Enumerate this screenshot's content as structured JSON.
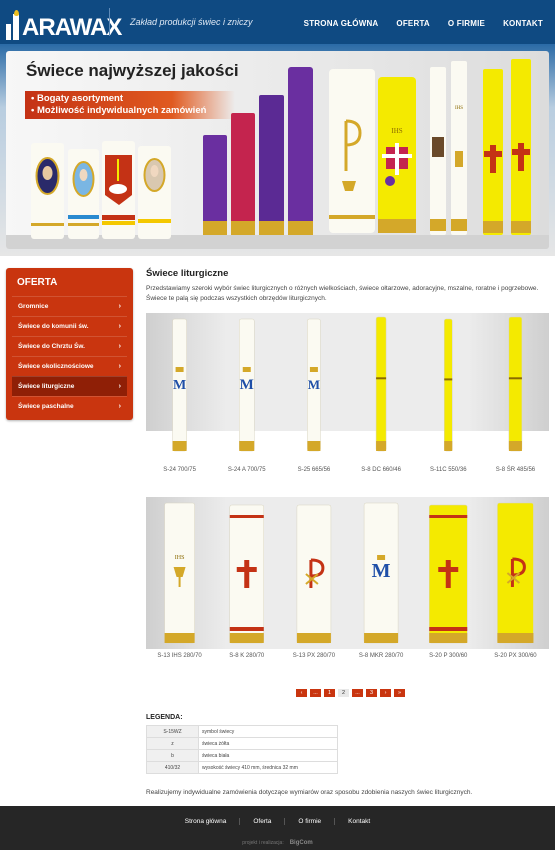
{
  "header": {
    "logo_text": "ARAWAX",
    "tagline": "Zakład produkcji świec i zniczy",
    "nav": [
      "STRONA GŁÓWNA",
      "OFERTA",
      "O FIRMIE",
      "KONTAKT"
    ]
  },
  "hero": {
    "title": "Świece najwyższej jakości",
    "bullets": [
      "• Bogaty asortyment",
      "• Możliwość indywidualnych zamówień"
    ],
    "decor_text": [
      "IHS",
      "IHS"
    ]
  },
  "sidebar": {
    "title": "OFERTA",
    "items": [
      {
        "label": "Gromnice",
        "active": false
      },
      {
        "label": "Świece do komunii św.",
        "active": false
      },
      {
        "label": "Świece do Chrztu Św.",
        "active": false
      },
      {
        "label": "Świece okolicznościowe",
        "active": false
      },
      {
        "label": "Świece liturgiczne",
        "active": true
      },
      {
        "label": "Świece paschalne",
        "active": false
      }
    ],
    "chevron": "›"
  },
  "main": {
    "title": "Świece liturgiczne",
    "intro": "Przedstawiamy szeroki wybór świec liturgicznych o różnych wielkościach, świece ołtarzowe, adoracyjne, mszalne, roratne i pogrzebowe. Świece te palą się podczas wszystkich obrzędów liturgicznych."
  },
  "products_row1": [
    {
      "code": "S-24 700/75",
      "color": "white",
      "decor": "M-blue"
    },
    {
      "code": "S-24 A 700/75",
      "color": "white",
      "decor": "M-blue"
    },
    {
      "code": "S-25 665/56",
      "color": "white",
      "decor": "M-blue"
    },
    {
      "code": "S-8 DC 660/46",
      "color": "yellow",
      "decor": "band"
    },
    {
      "code": "S-11C 550/36",
      "color": "yellow",
      "decor": "band"
    },
    {
      "code": "S-8 ŚR 485/56",
      "color": "yellow",
      "decor": "band"
    }
  ],
  "products_row2": [
    {
      "code": "S-13 IHS 280/70",
      "color": "white",
      "decor": "chalice"
    },
    {
      "code": "S-8 K 280/70",
      "color": "white",
      "decor": "cross-red"
    },
    {
      "code": "S-13 PX 280/70",
      "color": "white",
      "decor": "px"
    },
    {
      "code": "S-8 MKR 280/70",
      "color": "white",
      "decor": "M-blue"
    },
    {
      "code": "S-20 P 300/60",
      "color": "yellow",
      "decor": "cross-red"
    },
    {
      "code": "S-20 PX 300/60",
      "color": "yellow",
      "decor": "px"
    }
  ],
  "product_decor_text": "IHS",
  "pagination": [
    {
      "label": "‹",
      "current": false
    },
    {
      "label": "...",
      "current": false
    },
    {
      "label": "1",
      "current": false
    },
    {
      "label": "2",
      "current": true
    },
    {
      "label": "...",
      "current": false
    },
    {
      "label": "3",
      "current": false
    },
    {
      "label": "›",
      "current": false
    },
    {
      "label": "»",
      "current": false
    }
  ],
  "legend": {
    "title": "LEGENDA:",
    "rows": [
      {
        "key": "S-15WZ",
        "value": "symbol świecy"
      },
      {
        "key": "z",
        "value": "świeca żółta"
      },
      {
        "key": "b",
        "value": "świeca biała"
      },
      {
        "key": "410/32",
        "value": "wysokość świecy 410 mm, średnica 32 mm"
      }
    ]
  },
  "outro": "Realizujemy indywidualne zamówienia dotyczące wymiarów oraz sposobu zdobienia naszych świec liturgicznych.",
  "footer": {
    "nav": [
      "Strona główna",
      "Oferta",
      "O firmie",
      "Kontakt"
    ],
    "credits": "projekt i realizacja:",
    "credits_brand": "BigCom"
  },
  "colors": {
    "header": "#0f4a82",
    "accent": "#c9350f",
    "candle_yellow": "#f4ea00",
    "candle_white": "#fbfaf2",
    "purple": "#6a2fa0",
    "magenta": "#c4244e",
    "gold": "#d4a829"
  }
}
